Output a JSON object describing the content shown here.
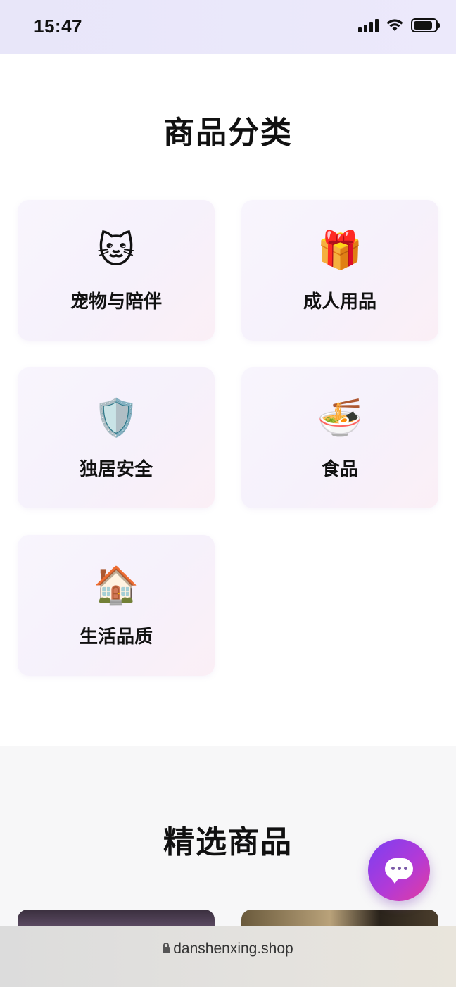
{
  "status_bar": {
    "time": "15:47"
  },
  "categories": {
    "title": "商品分类",
    "items": [
      {
        "label": "宠物与陪伴",
        "icon": "🐱",
        "icon_name": "cat-icon"
      },
      {
        "label": "成人用品",
        "icon": "🎁",
        "icon_name": "gift-icon"
      },
      {
        "label": "独居安全",
        "icon": "🛡️",
        "icon_name": "shield-icon"
      },
      {
        "label": "食品",
        "icon": "🍜",
        "icon_name": "noodle-bowl-icon"
      },
      {
        "label": "生活品质",
        "icon": "🏠",
        "icon_name": "house-icon"
      }
    ]
  },
  "featured": {
    "title": "精选商品"
  },
  "browser": {
    "url": "danshenxing.shop"
  },
  "colors": {
    "accent_start": "#7b3ff2",
    "accent_end": "#e23ca0"
  }
}
